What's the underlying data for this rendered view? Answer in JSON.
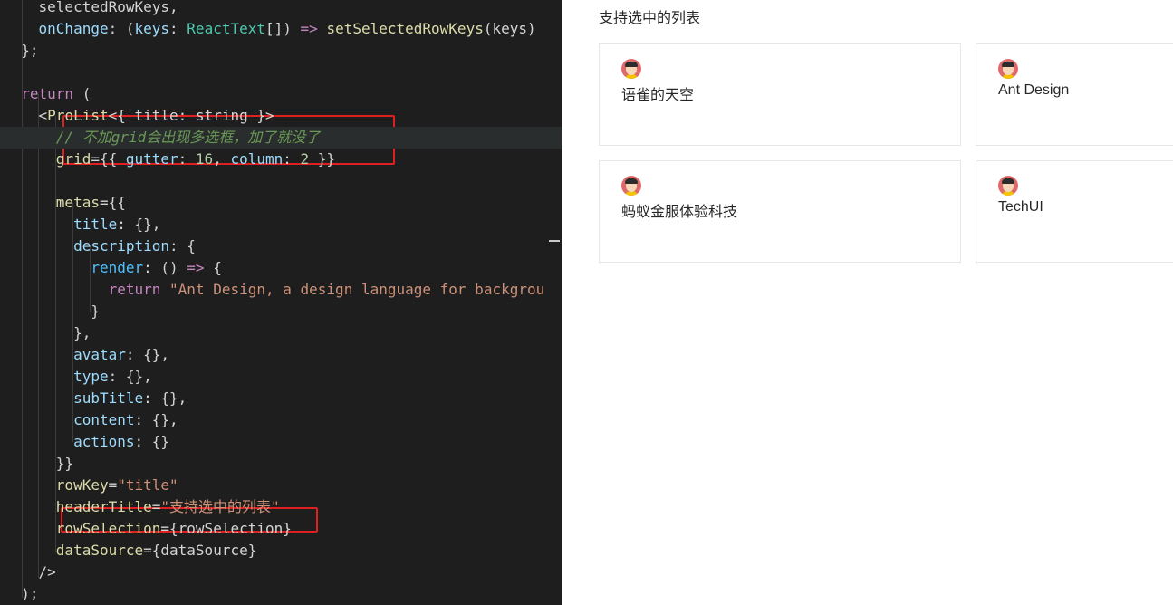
{
  "editor": {
    "colors": {
      "background": "#1e1e1e",
      "highlight_box": "#e02020"
    },
    "lines": [
      [
        [
          "    selectedRowKeys,",
          "tk-punc"
        ]
      ],
      [
        [
          "    ",
          "tk-punc"
        ],
        [
          "onChange",
          "tk-prop"
        ],
        [
          ": (",
          "tk-punc"
        ],
        [
          "keys",
          "tk-prop"
        ],
        [
          ": ",
          "tk-punc"
        ],
        [
          "ReactText",
          "tk-type"
        ],
        [
          "[]) ",
          "tk-punc"
        ],
        [
          "=>",
          "tk-kw"
        ],
        [
          " ",
          "tk-punc"
        ],
        [
          "setSelectedRowKeys",
          "tk-fnb"
        ],
        [
          "(keys)",
          "tk-punc"
        ]
      ],
      [
        [
          "  };",
          "tk-punc"
        ]
      ],
      [
        [
          "",
          "tk-punc"
        ]
      ],
      [
        [
          "  ",
          "tk-punc"
        ],
        [
          "return",
          "tk-kw"
        ],
        [
          " (",
          "tk-punc"
        ]
      ],
      [
        [
          "    <",
          "tk-punc"
        ],
        [
          "ProList",
          "tk-fn"
        ],
        [
          "<{ title: string }>",
          "tk-punc"
        ]
      ],
      [
        [
          "      ",
          "tk-punc"
        ],
        [
          "// 不加grid会出现多选框，加了就没了",
          "tk-cmt"
        ]
      ],
      [
        [
          "      ",
          "tk-punc"
        ],
        [
          "grid",
          "tk-fn"
        ],
        [
          "={{ ",
          "tk-punc"
        ],
        [
          "gutter",
          "tk-prop"
        ],
        [
          ": ",
          "tk-punc"
        ],
        [
          "16",
          "tk-num"
        ],
        [
          ", ",
          "tk-punc"
        ],
        [
          "column",
          "tk-prop"
        ],
        [
          ": ",
          "tk-punc"
        ],
        [
          "2",
          "tk-num"
        ],
        [
          " }}",
          "tk-punc"
        ]
      ],
      [
        [
          "",
          "tk-punc"
        ]
      ],
      [
        [
          "      ",
          "tk-punc"
        ],
        [
          "metas",
          "tk-fn"
        ],
        [
          "={{",
          "tk-punc"
        ]
      ],
      [
        [
          "        ",
          "tk-punc"
        ],
        [
          "title",
          "tk-prop"
        ],
        [
          ": {},",
          "tk-punc"
        ]
      ],
      [
        [
          "        ",
          "tk-punc"
        ],
        [
          "description",
          "tk-prop"
        ],
        [
          ": {",
          "tk-punc"
        ]
      ],
      [
        [
          "          ",
          "tk-punc"
        ],
        [
          "render",
          "tk-fnc"
        ],
        [
          ": () ",
          "tk-punc"
        ],
        [
          "=>",
          "tk-kw"
        ],
        [
          " {",
          "tk-punc"
        ]
      ],
      [
        [
          "            ",
          "tk-punc"
        ],
        [
          "return",
          "tk-kw"
        ],
        [
          " ",
          "tk-punc"
        ],
        [
          "\"Ant Design, a design language for backgrou",
          "tk-str"
        ]
      ],
      [
        [
          "          }",
          "tk-punc"
        ]
      ],
      [
        [
          "        },",
          "tk-punc"
        ]
      ],
      [
        [
          "        ",
          "tk-punc"
        ],
        [
          "avatar",
          "tk-prop"
        ],
        [
          ": {},",
          "tk-punc"
        ]
      ],
      [
        [
          "        ",
          "tk-punc"
        ],
        [
          "type",
          "tk-prop"
        ],
        [
          ": {},",
          "tk-punc"
        ]
      ],
      [
        [
          "        ",
          "tk-punc"
        ],
        [
          "subTitle",
          "tk-prop"
        ],
        [
          ": {},",
          "tk-punc"
        ]
      ],
      [
        [
          "        ",
          "tk-punc"
        ],
        [
          "content",
          "tk-prop"
        ],
        [
          ": {},",
          "tk-punc"
        ]
      ],
      [
        [
          "        ",
          "tk-punc"
        ],
        [
          "actions",
          "tk-prop"
        ],
        [
          ": {}",
          "tk-punc"
        ]
      ],
      [
        [
          "      }}",
          "tk-punc"
        ]
      ],
      [
        [
          "      ",
          "tk-punc"
        ],
        [
          "rowKey",
          "tk-fn"
        ],
        [
          "=",
          "tk-punc"
        ],
        [
          "\"title\"",
          "tk-str"
        ]
      ],
      [
        [
          "      ",
          "tk-punc"
        ],
        [
          "headerTitle",
          "tk-fn"
        ],
        [
          "=",
          "tk-punc"
        ],
        [
          "\"支持选中的列表\"",
          "tk-str"
        ]
      ],
      [
        [
          "      ",
          "tk-punc"
        ],
        [
          "rowSelection",
          "tk-fn"
        ],
        [
          "={rowSelection}",
          "tk-punc"
        ]
      ],
      [
        [
          "      ",
          "tk-punc"
        ],
        [
          "dataSource",
          "tk-fn"
        ],
        [
          "={dataSource}",
          "tk-punc"
        ]
      ],
      [
        [
          "    />",
          "tk-punc"
        ]
      ],
      [
        [
          "  );",
          "tk-punc"
        ]
      ],
      [
        [
          "};",
          "tk-punc"
        ]
      ]
    ]
  },
  "preview": {
    "header_title": "支持选中的列表",
    "cards": [
      {
        "title": "语雀的天空",
        "avatar_icon": "user-avatar-icon"
      },
      {
        "title": "Ant Design",
        "avatar_icon": "user-avatar-icon"
      },
      {
        "title": "蚂蚁金服体验科技",
        "avatar_icon": "user-avatar-icon"
      },
      {
        "title": "TechUI",
        "avatar_icon": "user-avatar-icon"
      }
    ]
  }
}
